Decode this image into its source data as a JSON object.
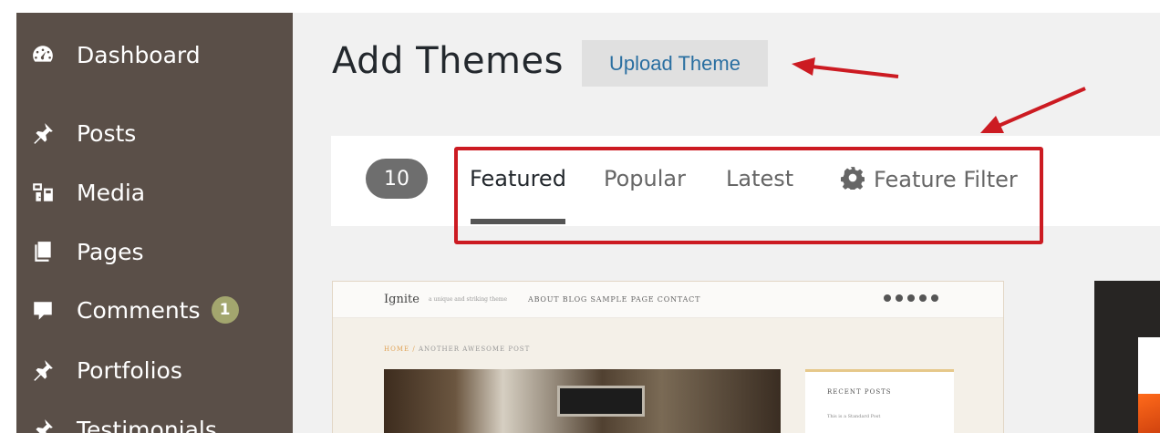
{
  "sidebar": {
    "items": [
      {
        "label": "Dashboard",
        "icon": "dashboard-icon"
      },
      {
        "label": "Posts",
        "icon": "pin-icon"
      },
      {
        "label": "Media",
        "icon": "media-icon"
      },
      {
        "label": "Pages",
        "icon": "pages-icon"
      },
      {
        "label": "Comments",
        "icon": "comment-icon",
        "badge": "1"
      },
      {
        "label": "Portfolios",
        "icon": "pin-icon"
      },
      {
        "label": "Testimonials",
        "icon": "pin-icon"
      }
    ]
  },
  "header": {
    "title": "Add Themes",
    "upload_label": "Upload Theme"
  },
  "filter": {
    "count": "10",
    "tabs": [
      {
        "label": "Featured",
        "active": true
      },
      {
        "label": "Popular",
        "active": false
      },
      {
        "label": "Latest",
        "active": false
      }
    ],
    "feature_filter": "Feature Filter"
  },
  "theme_preview": {
    "logo": "Ignite",
    "tagline": "a unique and striking theme",
    "nav": "ABOUT   BLOG   SAMPLE PAGE   CONTACT",
    "crumb_home": "HOME /",
    "crumb_title": " ANOTHER AWESOME POST",
    "widget_title": "RECENT POSTS",
    "widget_item": "This is a Standard Post"
  },
  "colors": {
    "sidebar_bg": "#5a4f48",
    "accent_link": "#2a6fa1",
    "annotation_red": "#cc1b22",
    "badge_bg": "#a3a66e"
  }
}
